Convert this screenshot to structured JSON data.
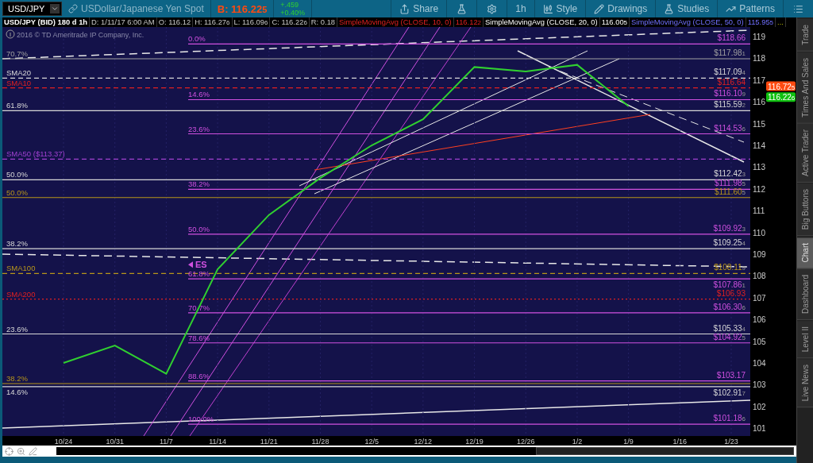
{
  "toolbar": {
    "symbol": "USD/JPY",
    "description": "USDollar/Japanese Yen Spot",
    "bid": {
      "text": "B: 116.22",
      "tick": "5"
    },
    "change": "+.459",
    "change_pct": "+0.40%",
    "buttons": [
      {
        "kind": "share",
        "label": "Share"
      },
      {
        "kind": "flask"
      },
      {
        "kind": "gear"
      },
      {
        "kind": "text",
        "label": "1h"
      },
      {
        "kind": "style",
        "label": "Style"
      },
      {
        "kind": "drawings",
        "label": "Drawings"
      },
      {
        "kind": "studies",
        "label": "Studies"
      },
      {
        "kind": "patterns",
        "label": "Patterns"
      },
      {
        "kind": "menu"
      }
    ]
  },
  "info_bar": [
    {
      "text": "USD/JPY (BID) 180 d 1h",
      "kind": "title"
    },
    {
      "text": "D: 1/11/17 6:00 AM",
      "kind": "field"
    },
    {
      "text": "O: 116.12",
      "kind": "field"
    },
    {
      "text": "H: 116.27",
      "tick": "6",
      "kind": "field"
    },
    {
      "text": "L: 116.09",
      "tick": "6",
      "kind": "field"
    },
    {
      "text": "C: 116.22",
      "tick": "6",
      "kind": "field"
    },
    {
      "text": "R: 0.18",
      "kind": "field"
    },
    {
      "text": "SimpleMovingAvg (CLOSE, 10, 0)",
      "kind": "study1"
    },
    {
      "text": "116.12",
      "tick": "2",
      "kind": "study1"
    },
    {
      "text": "SimpleMovingAvg (CLOSE, 20, 0)",
      "kind": "study2"
    },
    {
      "text": "116.00",
      "tick": "5",
      "kind": "study2"
    },
    {
      "text": "SimpleMovingAvg (CLOSE, 50, 0)",
      "kind": "study3"
    },
    {
      "text": "115.95",
      "tick": "5",
      "kind": "study3"
    },
    {
      "text": "...",
      "kind": "more"
    }
  ],
  "chart": {
    "copyright": "2016 © TD Ameritrade IP Company, Inc.",
    "price_tags": [
      {
        "text": "116.72",
        "tick": "5",
        "color": "#ff4a10"
      },
      {
        "text": "116.22",
        "tick": "6",
        "color": "#10c010"
      }
    ],
    "levels": [
      {
        "kind": "fib",
        "name": "0.0%"
      },
      {
        "kind": "line",
        "tick": "1",
        "name": "70.7%"
      },
      {
        "kind": "dashed",
        "tick": "4",
        "name": "SMA20"
      },
      {
        "kind": "dashed",
        "name": "SMA10"
      },
      {
        "kind": "fib",
        "tick": "9",
        "name": "14.6%"
      },
      {
        "kind": "line",
        "tick": "2",
        "name": "61.8%"
      },
      {
        "kind": "fib",
        "tick": "6",
        "name": "23.6%"
      },
      {
        "kind": "dashed",
        "name": "SMA50 ($113.37)"
      },
      {
        "kind": "line",
        "tick": "3",
        "name": "50.0%"
      },
      {
        "kind": "fib",
        "tick": "5",
        "name": "38.2%"
      },
      {
        "kind": "line",
        "tick": "5",
        "name": "50.0%"
      },
      {
        "kind": "fib",
        "tick": "3",
        "name": "50.0%"
      },
      {
        "kind": "line",
        "tick": "4",
        "name": "38.2%"
      },
      {
        "kind": "dashed",
        "tick": "9",
        "name": "SMA100"
      },
      {
        "kind": "fib",
        "tick": "1",
        "name": "61.8%",
        "marker": "ES"
      },
      {
        "kind": "dotted",
        "name": "SMA200"
      },
      {
        "kind": "fib",
        "tick": "6",
        "name": "70.7%"
      },
      {
        "kind": "line",
        "tick": "4",
        "name": "23.6%"
      },
      {
        "kind": "fib",
        "tick": "5",
        "name": "78.6%"
      },
      {
        "kind": "fib",
        "name": "88.6%"
      },
      {
        "kind": "line",
        "name": "38.2%"
      },
      {
        "kind": "line",
        "tick": "7",
        "name": "14.6%"
      },
      {
        "kind": "fib",
        "tick": "6",
        "name": "100.0%"
      }
    ],
    "chart_data": {
      "type": "line",
      "categories": [
        "10/24",
        "10/31",
        "11/7",
        "11/14",
        "11/21",
        "11/28",
        "12/5",
        "12/12",
        "12/19",
        "12/26",
        "1/2",
        "1/9",
        "1/16",
        "1/23"
      ],
      "series": [
        {
          "color": "#30d030",
          "values": [
            104.0,
            104.8,
            103.5,
            108.3,
            110.8,
            112.5,
            114.0,
            115.2,
            117.6,
            117.4,
            117.7,
            115.8,
            null,
            null
          ]
        }
      ],
      "ylim": [
        100.64,
        119.44
      ],
      "yticks": [
        101,
        102,
        103,
        104,
        105,
        106,
        107,
        108,
        109,
        110,
        111,
        112,
        113,
        114,
        115,
        116,
        117,
        118,
        119
      ],
      "grid": true,
      "ref_lines": [
        {
          "axis": "y",
          "value": 118.66,
          "color": "#d050e0",
          "label": "$118.66"
        },
        {
          "axis": "y",
          "value": 117.98,
          "color": "#a0a0a0",
          "label": "$117.98"
        },
        {
          "axis": "y",
          "value": 117.09,
          "color": "#d8d8d8",
          "label": "$117.09"
        },
        {
          "axis": "y",
          "value": 116.64,
          "color": "#e02020",
          "label": "$116.64"
        },
        {
          "axis": "y",
          "value": 116.1,
          "color": "#d050e0",
          "label": "$116.10"
        },
        {
          "axis": "y",
          "value": 115.59,
          "color": "#d8d8d8",
          "label": "$115.59"
        },
        {
          "axis": "y",
          "value": 114.53,
          "color": "#d050e0",
          "label": "$114.53"
        },
        {
          "axis": "y",
          "value": 113.37,
          "color": "#a040d0"
        },
        {
          "axis": "y",
          "value": 112.42,
          "color": "#d8d8d8",
          "label": "$112.42"
        },
        {
          "axis": "y",
          "value": 111.98,
          "color": "#d050e0",
          "label": "$111.98"
        },
        {
          "axis": "y",
          "value": 111.6,
          "color": "#b8961a",
          "label": "$111.60"
        },
        {
          "axis": "y",
          "value": 109.92,
          "color": "#d050e0",
          "label": "$109.92"
        },
        {
          "axis": "y",
          "value": 109.25,
          "color": "#d8d8d8",
          "label": "$109.25"
        },
        {
          "axis": "y",
          "value": 108.11,
          "color": "#b8961a",
          "label": "$108.11"
        },
        {
          "axis": "y",
          "value": 107.86,
          "color": "#d050e0",
          "label": "$107.86"
        },
        {
          "axis": "y",
          "value": 106.93,
          "color": "#e02020",
          "label": "$106.93"
        },
        {
          "axis": "y",
          "value": 106.3,
          "color": "#d050e0",
          "label": "$106.30"
        },
        {
          "axis": "y",
          "value": 105.33,
          "color": "#d8d8d8",
          "label": "$105.33"
        },
        {
          "axis": "y",
          "value": 104.92,
          "color": "#d050e0",
          "label": "$104.92"
        },
        {
          "axis": "y",
          "value": 103.17,
          "color": "#d050e0",
          "label": "$103.17"
        },
        {
          "axis": "y",
          "value": 103.05,
          "color": "#b8961a"
        },
        {
          "axis": "y",
          "value": 102.91,
          "color": "#d8d8d8",
          "label": "$102.91"
        },
        {
          "axis": "y",
          "value": 101.18,
          "color": "#d050e0",
          "label": "$101.18"
        }
      ]
    }
  },
  "sidebar": [
    {
      "label": "Trade",
      "selected": false
    },
    {
      "label": "Times And Sales",
      "selected": false
    },
    {
      "label": "Active Trader",
      "selected": false
    },
    {
      "label": "Big Buttons",
      "selected": false
    },
    {
      "label": "Chart",
      "selected": true
    },
    {
      "label": "Dashboard",
      "selected": false
    },
    {
      "label": "Level II",
      "selected": false
    },
    {
      "label": "Live News",
      "selected": false
    }
  ]
}
